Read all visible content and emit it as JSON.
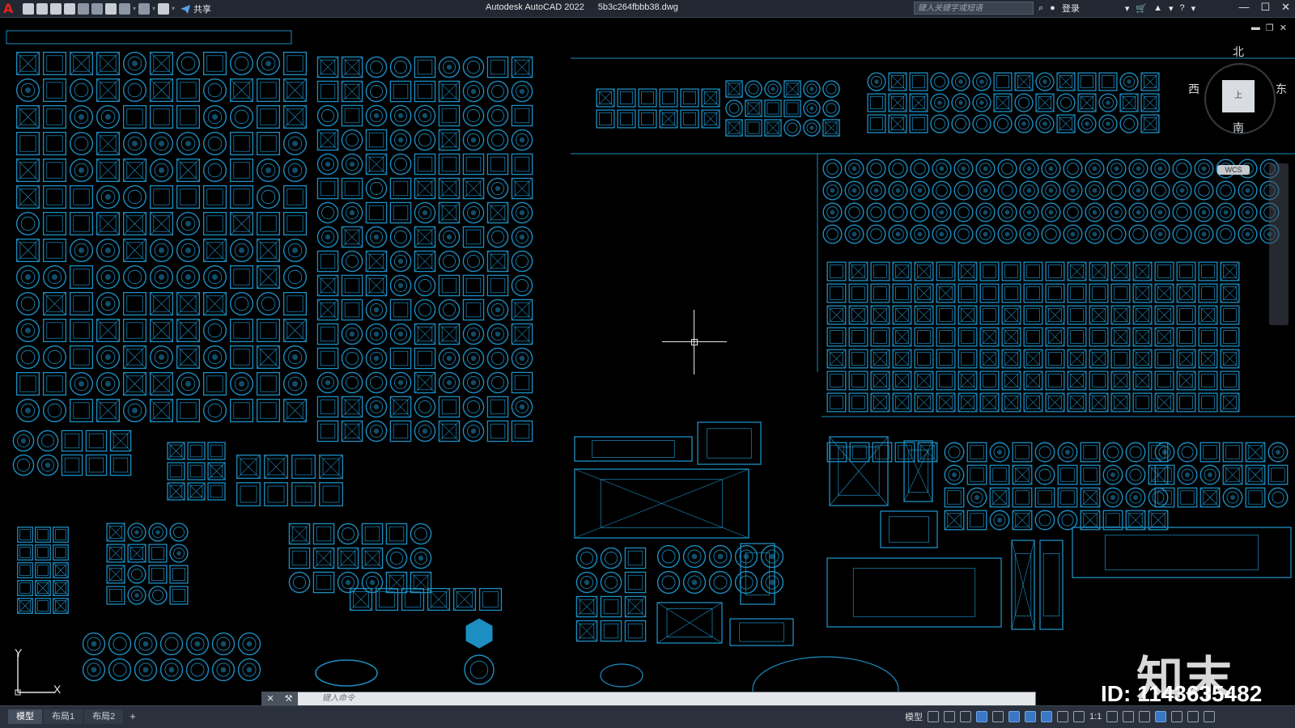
{
  "titlebar": {
    "app_name": "Autodesk AutoCAD 2022",
    "file_name": "5b3c264fbbb38.dwg",
    "share_label": "共享",
    "search_placeholder": "键入关键字或短语",
    "login_label": "登录",
    "quick_access_icons": [
      "new-icon",
      "open-icon",
      "save-icon",
      "saveas-icon",
      "publish-icon",
      "plot-preview-icon",
      "print-icon",
      "undo-icon",
      "redo-icon",
      "workspace-icon"
    ]
  },
  "viewcube": {
    "north": "北",
    "south": "南",
    "east": "东",
    "west": "西",
    "face": "上",
    "wcs": "WCS"
  },
  "ucs": {
    "x_label": "X",
    "y_label": "Y"
  },
  "command": {
    "placeholder": "键入命令"
  },
  "layout_tabs": [
    "模型",
    "布局1",
    "布局2"
  ],
  "add_tab": "+",
  "status": {
    "model_label": "模型",
    "scale": "1:1"
  },
  "watermark": {
    "logo": "知末",
    "id": "ID: 1143635482"
  },
  "colors": {
    "drawing_lines": "#1d8ec2",
    "background": "#000000",
    "titlebar": "#222832"
  }
}
